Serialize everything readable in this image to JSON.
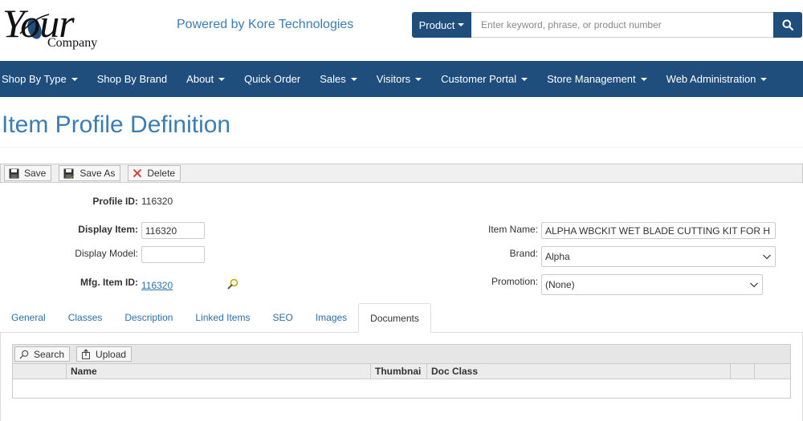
{
  "header": {
    "logo_text": "Your",
    "logo_sub": "Company",
    "powered_by": "Powered by Kore Technologies"
  },
  "search": {
    "category_label": "Product",
    "placeholder": "Enter keyword, phrase, or product number"
  },
  "nav": {
    "items": [
      {
        "label": "Shop By Type",
        "dropdown": true
      },
      {
        "label": "Shop By Brand",
        "dropdown": false
      },
      {
        "label": "About",
        "dropdown": true
      },
      {
        "label": "Quick Order",
        "dropdown": false
      },
      {
        "label": "Sales",
        "dropdown": true
      },
      {
        "label": "Visitors",
        "dropdown": true
      },
      {
        "label": "Customer Portal",
        "dropdown": true
      },
      {
        "label": "Store Management",
        "dropdown": true
      },
      {
        "label": "Web Administration",
        "dropdown": true
      }
    ]
  },
  "page": {
    "title": "Item Profile Definition"
  },
  "toolbar": {
    "save": "Save",
    "save_as": "Save As",
    "delete": "Delete"
  },
  "form": {
    "profile_id_label": "Profile ID:",
    "profile_id": "116320",
    "display_item_label": "Display Item:",
    "display_item": "116320",
    "display_model_label": "Display Model:",
    "display_model": "",
    "mfg_item_id_label": "Mfg. Item ID:",
    "mfg_item_id": "116320",
    "item_name_label": "Item Name:",
    "item_name": "ALPHA WBCKIT WET BLADE CUTTING KIT FOR H",
    "brand_label": "Brand:",
    "brand": "Alpha",
    "promotion_label": "Promotion:",
    "promotion": "(None)"
  },
  "tabs": {
    "items": [
      "General",
      "Classes",
      "Description",
      "Linked Items",
      "SEO",
      "Images",
      "Documents"
    ],
    "active": "Documents"
  },
  "documents": {
    "search": "Search",
    "upload": "Upload",
    "columns": [
      "",
      "Name",
      "Thumbnai",
      "Doc Class",
      "",
      ""
    ]
  },
  "colors": {
    "brand_blue": "#1f4e7d",
    "title_blue": "#3a7db5",
    "link_blue": "#2a6fa8",
    "delete_red": "#d9302c"
  }
}
